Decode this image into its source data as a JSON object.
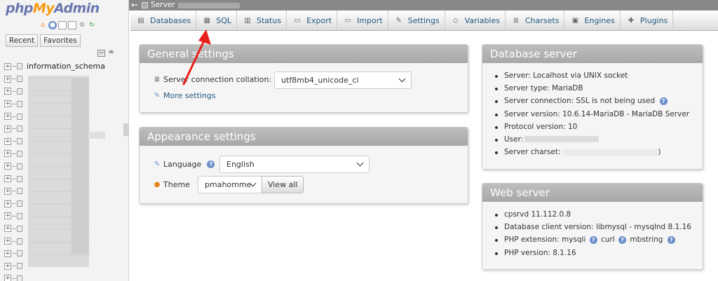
{
  "logo": {
    "php": "php",
    "my": "My",
    "admin": "Admin"
  },
  "nav": {
    "tabs": [
      "Recent",
      "Favorites"
    ],
    "collapse_symbol": "−",
    "link_symbol": "∞",
    "first_db": "information_schema"
  },
  "topbar": {
    "back": "←",
    "crumb": "Server"
  },
  "menu": [
    {
      "label": "Databases",
      "icon": "databases-icon",
      "glyph": "▤"
    },
    {
      "label": "SQL",
      "icon": "sql-icon",
      "glyph": "▦"
    },
    {
      "label": "Status",
      "icon": "status-icon",
      "glyph": "▥"
    },
    {
      "label": "Export",
      "icon": "export-icon",
      "glyph": "▭"
    },
    {
      "label": "Import",
      "icon": "import-icon",
      "glyph": "▭"
    },
    {
      "label": "Settings",
      "icon": "wrench-icon",
      "glyph": "✎"
    },
    {
      "label": "Variables",
      "icon": "variables-icon",
      "glyph": "◇"
    },
    {
      "label": "Charsets",
      "icon": "charsets-icon",
      "glyph": "≣"
    },
    {
      "label": "Engines",
      "icon": "engines-icon",
      "glyph": "▣"
    },
    {
      "label": "Plugins",
      "icon": "plugins-icon",
      "glyph": "✚"
    }
  ],
  "general": {
    "title": "General settings",
    "collation_label": "Server connection collation:",
    "collation_value": "utf8mb4_unicode_ci",
    "more_settings": "More settings"
  },
  "appearance": {
    "title": "Appearance settings",
    "language_label": "Language",
    "language_value": "English",
    "theme_label": "Theme",
    "theme_value": "pmahomme",
    "view_all": "View all"
  },
  "db_server": {
    "title": "Database server",
    "items": [
      "Server: Localhost via UNIX socket",
      "Server type: MariaDB",
      "Server connection: SSL is not being used",
      "Server version: 10.6.14-MariaDB - MariaDB Server",
      "Protocol version: 10",
      "User:",
      "Server charset:"
    ],
    "charset_close": ")"
  },
  "web_server": {
    "title": "Web server",
    "items": [
      "cpsrvd 11.112.0.8",
      "Database client version: libmysql - mysqlnd 8.1.16",
      "PHP extension: mysqli",
      "PHP version: 8.1.16"
    ],
    "ext_curl": "curl",
    "ext_mbstring": "mbstring"
  },
  "help_glyph": "?",
  "colors": {
    "accent": "#235a81",
    "annotation": "#e8201a",
    "panel_head": "#aeaeae"
  }
}
